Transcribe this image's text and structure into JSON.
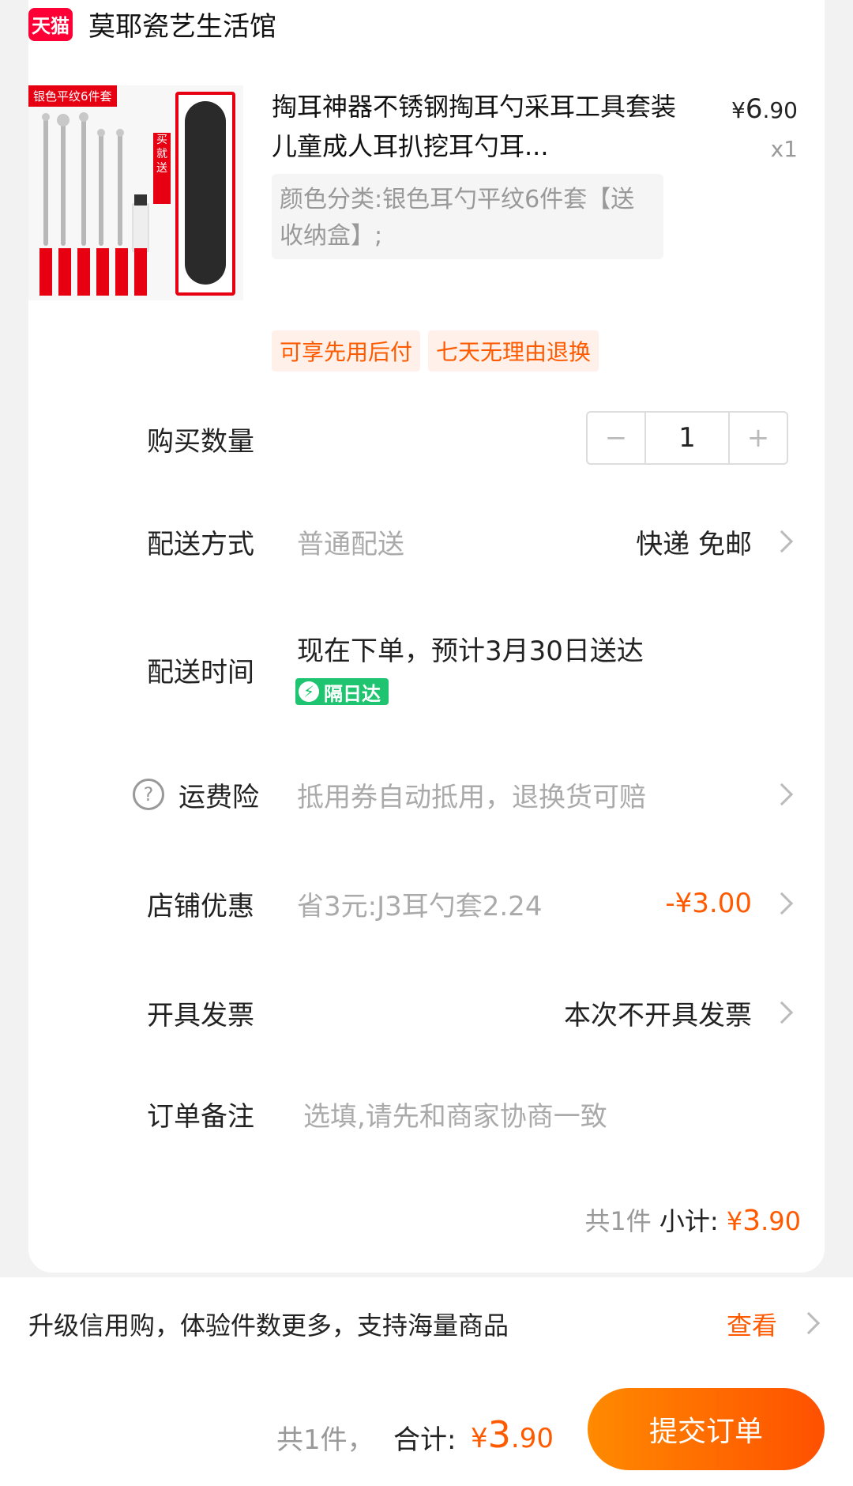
{
  "shop": {
    "badge": "天猫",
    "name": "莫耶瓷艺生活馆"
  },
  "product": {
    "image_label": "银色平纹6件套",
    "image_tag": "买就送",
    "title": "掏耳神器不锈钢掏耳勺采耳工具套装儿童成人耳扒挖耳勺耳...",
    "price_symbol": "¥",
    "price_int": "6",
    "price_dec": ".90",
    "quantity": "x1",
    "sku": "颜色分类:银色耳勺平纹6件套【送收纳盒】;"
  },
  "tags": [
    "可享先用后付",
    "七天无理由退换"
  ],
  "quantity_row": {
    "label": "购买数量",
    "minus": "−",
    "value": "1",
    "plus": "+"
  },
  "delivery_method": {
    "label": "配送方式",
    "hint": "普通配送",
    "value": "快递 免邮"
  },
  "delivery_time": {
    "label": "配送时间",
    "text": "现在下单，预计3月30日送达",
    "badge": "隔日达",
    "badge_icon": "⚡"
  },
  "shipping_insurance": {
    "label": "运费险",
    "hint": "抵用券自动抵用，退换货可赔",
    "icon": "?"
  },
  "shop_discount": {
    "label": "店铺优惠",
    "hint": "省3元:J3耳勺套2.24",
    "value": "-¥3.00"
  },
  "invoice": {
    "label": "开具发票",
    "value": "本次不开具发票"
  },
  "note": {
    "label": "订单备注",
    "placeholder": "选填,请先和商家协商一致"
  },
  "subtotal": {
    "count": "共1件",
    "label": "小计:",
    "symbol": "¥",
    "int": "3",
    "dec": ".90"
  },
  "credit": {
    "text": "升级信用购，体验件数更多，支持海量商品",
    "link": "查看"
  },
  "footer": {
    "count": "共1件，",
    "label": "合计:",
    "symbol": "¥",
    "int": "3",
    "dec": ".90",
    "submit": "提交订单"
  },
  "colors": {
    "accent": "#ff5a00",
    "tmall_red": "#ff0036",
    "green_badge": "#1fc470"
  }
}
